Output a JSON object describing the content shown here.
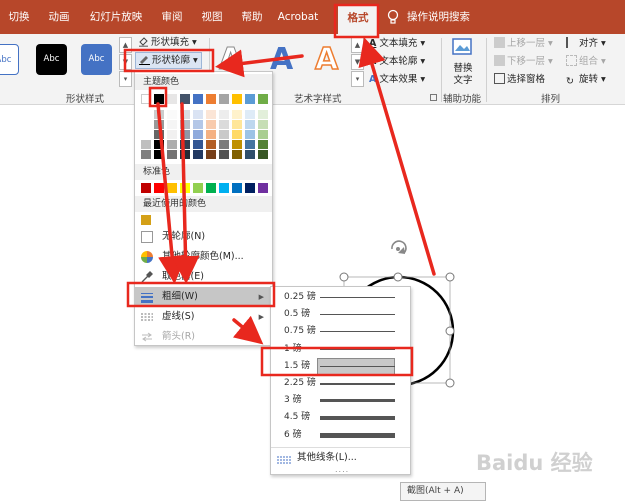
{
  "tabs": [
    {
      "label": "切换"
    },
    {
      "label": "动画"
    },
    {
      "label": "幻灯片放映"
    },
    {
      "label": "审阅"
    },
    {
      "label": "视图"
    },
    {
      "label": "帮助"
    },
    {
      "label": "Acrobat"
    },
    {
      "label": "格式"
    }
  ],
  "active_tab": "格式",
  "tell_me": "操作说明搜索",
  "ribbon": {
    "shape_styles": {
      "swatches": [
        "Abc",
        "Abc",
        "Abc"
      ],
      "fill_label": "形状填充",
      "outline_label": "形状轮廓",
      "group_label": "形状样式"
    },
    "wordart": {
      "letters": [
        "A",
        "A",
        "A"
      ],
      "text_fill": "文本填充",
      "text_outline": "文本轮廓",
      "text_effects": "文本效果",
      "group_label": "艺术字样式"
    },
    "accessibility": {
      "alt_text": "替换文字",
      "alt_text_line1": "替换",
      "alt_text_line2": "文字",
      "group_label": "辅助功能"
    },
    "arrange": {
      "bring_forward": "上移一层",
      "send_backward": "下移一层",
      "selection_pane": "选择窗格",
      "align": "对齐",
      "group": "组合",
      "rotate": "旋转",
      "group_label": "排列"
    }
  },
  "outline_menu": {
    "theme_colors_header": "主题颜色",
    "standard_colors_header": "标准色",
    "recent_colors_header": "最近使用的颜色",
    "no_outline": "无轮廓(N)",
    "more_colors": "其他轮廓颜色(M)...",
    "eyedropper": "取色器(E)",
    "weight": "粗细(W)",
    "dashes": "虚线(S)",
    "arrows": "箭头(R)",
    "theme_top_row": [
      "#ffffff",
      "#000000",
      "#e7e6e6",
      "#44546a",
      "#4472c4",
      "#ed7d31",
      "#a5a5a5",
      "#ffc000",
      "#5b9bd5",
      "#70ad47"
    ],
    "standard_colors": [
      "#c00000",
      "#ff0000",
      "#ffc000",
      "#ffff00",
      "#92d050",
      "#00b050",
      "#00b0f0",
      "#0070c0",
      "#002060",
      "#7030a0"
    ],
    "recent_colors": [
      "#d4a017"
    ]
  },
  "weight_submenu": {
    "items": [
      {
        "label": "0.25 磅",
        "pt": 0.25
      },
      {
        "label": "0.5 磅",
        "pt": 0.5
      },
      {
        "label": "0.75 磅",
        "pt": 0.75
      },
      {
        "label": "1 磅",
        "pt": 1
      },
      {
        "label": "1.5 磅",
        "pt": 1.5
      },
      {
        "label": "2.25 磅",
        "pt": 2.25
      },
      {
        "label": "3 磅",
        "pt": 3
      },
      {
        "label": "4.5 磅",
        "pt": 4.5
      },
      {
        "label": "6 磅",
        "pt": 6
      }
    ],
    "selected": "1.5 磅",
    "more_lines": "其他线条(L)..."
  },
  "tooltip": "截图(Alt + A)",
  "watermark": "Baidu 经验",
  "colors": {
    "ribbon_accent": "#b7472a",
    "annotation": "#e8281e"
  }
}
